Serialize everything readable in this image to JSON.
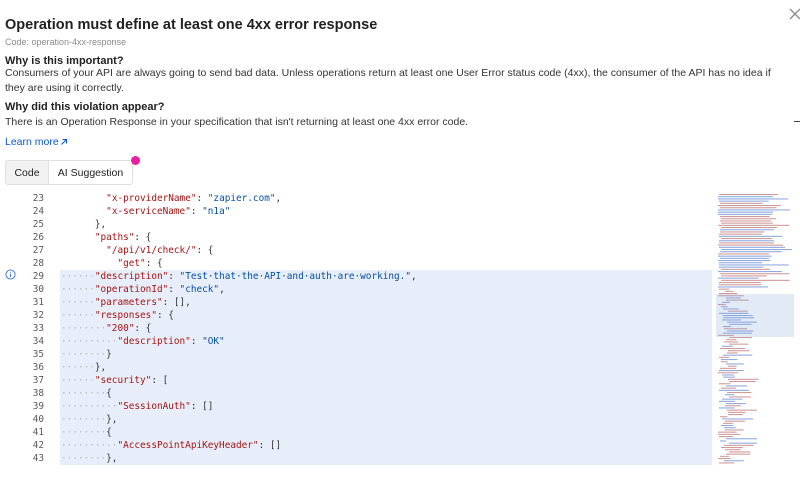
{
  "header": {
    "title": "Operation must define at least one 4xx error response",
    "code_label": "Code: operation-4xx-response"
  },
  "sections": [
    {
      "title": "Why is this important?",
      "body": "Consumers of your API are always going to send bad data. Unless operations return at least one User Error status code (4xx), the consumer of the API has no idea if they are using it correctly."
    },
    {
      "title": "Why did this violation appear?",
      "body": "There is an Operation Response in your specification that isn't returning at least one 4xx error code."
    }
  ],
  "learn_more": "Learn more",
  "tabs": [
    {
      "label": "Code",
      "active": true
    },
    {
      "label": "AI Suggestion",
      "active": false
    }
  ],
  "icons": {
    "close": "close-icon",
    "external": "external-link-icon",
    "info": "info-icon"
  },
  "colors": {
    "accent_link": "#0b57c7",
    "badge": "#e91ea0",
    "highlight": "#e8eef9",
    "key": "#a31515",
    "string": "#0451a5"
  },
  "code": {
    "lines": [
      {
        "n": "23",
        "hl": false,
        "ws": "",
        "segs": [
          [
            "p",
            "  "
          ],
          [
            "k",
            "\"x-providerName\""
          ],
          [
            "p",
            ": "
          ],
          [
            "s",
            "\"zapier.com\""
          ],
          [
            "p",
            ","
          ]
        ]
      },
      {
        "n": "24",
        "hl": false,
        "ws": "",
        "segs": [
          [
            "p",
            "  "
          ],
          [
            "k",
            "\"x-serviceName\""
          ],
          [
            "p",
            ": "
          ],
          [
            "s",
            "\"n1a\""
          ]
        ]
      },
      {
        "n": "25",
        "hl": false,
        "ws": "",
        "segs": [
          [
            "p",
            "},"
          ]
        ]
      },
      {
        "n": "26",
        "hl": false,
        "ws": "",
        "segs": [
          [
            "k",
            "\"paths\""
          ],
          [
            "p",
            ": {"
          ]
        ]
      },
      {
        "n": "27",
        "hl": false,
        "ws": "",
        "segs": [
          [
            "p",
            "  "
          ],
          [
            "k",
            "\"/api/v1/check/\""
          ],
          [
            "p",
            ": {"
          ]
        ]
      },
      {
        "n": "28",
        "hl": false,
        "ws": "",
        "segs": [
          [
            "p",
            "    "
          ],
          [
            "k",
            "\"get\""
          ],
          [
            "p",
            ": {"
          ]
        ]
      },
      {
        "n": "29",
        "hl": true,
        "ws": "······",
        "segs": [
          [
            "k",
            "\"description\""
          ],
          [
            "p",
            ": "
          ],
          [
            "s",
            "\"Test·that·the·API·and·auth·are·working.\""
          ],
          [
            "p",
            ","
          ]
        ]
      },
      {
        "n": "30",
        "hl": true,
        "ws": "······",
        "segs": [
          [
            "k",
            "\"operationId\""
          ],
          [
            "p",
            ": "
          ],
          [
            "s",
            "\"check\""
          ],
          [
            "p",
            ","
          ]
        ]
      },
      {
        "n": "31",
        "hl": true,
        "ws": "······",
        "segs": [
          [
            "k",
            "\"parameters\""
          ],
          [
            "p",
            ": [],"
          ]
        ]
      },
      {
        "n": "32",
        "hl": true,
        "ws": "······",
        "segs": [
          [
            "k",
            "\"responses\""
          ],
          [
            "p",
            ": {"
          ]
        ]
      },
      {
        "n": "33",
        "hl": true,
        "ws": "········",
        "segs": [
          [
            "k",
            "\"200\""
          ],
          [
            "p",
            ": {"
          ]
        ]
      },
      {
        "n": "34",
        "hl": true,
        "ws": "··········",
        "segs": [
          [
            "k",
            "\"description\""
          ],
          [
            "p",
            ": "
          ],
          [
            "s",
            "\"OK\""
          ]
        ]
      },
      {
        "n": "35",
        "hl": true,
        "ws": "········",
        "segs": [
          [
            "p",
            "}"
          ]
        ]
      },
      {
        "n": "36",
        "hl": true,
        "ws": "······",
        "segs": [
          [
            "p",
            "},"
          ]
        ]
      },
      {
        "n": "37",
        "hl": true,
        "ws": "······",
        "segs": [
          [
            "k",
            "\"security\""
          ],
          [
            "p",
            ": ["
          ]
        ]
      },
      {
        "n": "38",
        "hl": true,
        "ws": "········",
        "segs": [
          [
            "p",
            "{"
          ]
        ]
      },
      {
        "n": "39",
        "hl": true,
        "ws": "··········",
        "segs": [
          [
            "k",
            "\"SessionAuth\""
          ],
          [
            "p",
            ": []"
          ]
        ]
      },
      {
        "n": "40",
        "hl": true,
        "ws": "········",
        "segs": [
          [
            "p",
            "},"
          ]
        ]
      },
      {
        "n": "41",
        "hl": true,
        "ws": "········",
        "segs": [
          [
            "p",
            "{"
          ]
        ]
      },
      {
        "n": "42",
        "hl": true,
        "ws": "··········",
        "segs": [
          [
            "k",
            "\"AccessPointApiKeyHeader\""
          ],
          [
            "p",
            ": []"
          ]
        ]
      },
      {
        "n": "43",
        "hl": true,
        "ws": "········",
        "segs": [
          [
            "p",
            "},"
          ]
        ]
      }
    ]
  }
}
